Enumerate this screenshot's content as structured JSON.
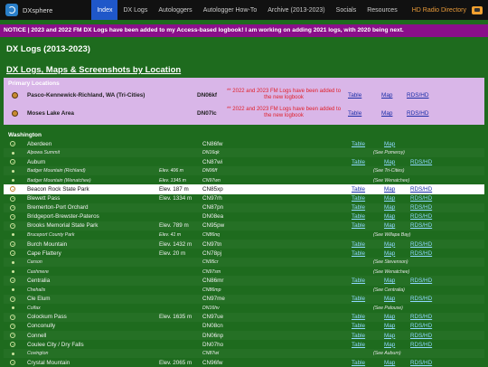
{
  "nav": {
    "brand": "DXsphere",
    "items": [
      {
        "label": "Index",
        "active": true
      },
      {
        "label": "DX Logs",
        "active": false
      },
      {
        "label": "Autologgers",
        "active": false
      },
      {
        "label": "Autologger How-To",
        "active": false
      },
      {
        "label": "Archive (2013-2023)",
        "active": false
      },
      {
        "label": "Socials",
        "active": false
      },
      {
        "label": "Resources",
        "active": false
      }
    ],
    "hd_label": "HD Radio Directory"
  },
  "notice": "NOTICE | 2023 and 2022 FM DX Logs have been added to my Access-based logbook! I am working on adding 2021 logs, with 2020 being next.",
  "page_title": "DX Logs (2013-2023)",
  "section_title": "DX Logs, Maps & Screenshots by Location",
  "primary": {
    "heading": "Primary Locations",
    "rows": [
      {
        "name": "Pasco-Kennewick-Richland, WA (Tri-Cities)",
        "grid": "DN06kf",
        "note": "** 2022 and 2023 FM Logs have been added to the new logbook",
        "table": "Table",
        "map": "Map",
        "rds": "RDS/HD"
      },
      {
        "name": "Moses Lake Area",
        "grid": "DN07lc",
        "note": "** 2022 and 2023 FM Logs have been added to the new logbook",
        "table": "Table",
        "map": "Map",
        "rds": "RDS/HD"
      }
    ]
  },
  "washington": {
    "heading": "Washington",
    "rows": [
      {
        "name": "Aberdeen",
        "elev": "",
        "grid": "CN86fw",
        "table": "Table",
        "map": "Map",
        "rds": "",
        "see": "",
        "small": false,
        "sel": false
      },
      {
        "name": "Alpowa Summit",
        "elev": "",
        "grid": "DN16qk",
        "table": "",
        "map": "",
        "rds": "",
        "see": "(See Pomeroy)",
        "small": true,
        "sel": false
      },
      {
        "name": "Auburn",
        "elev": "",
        "grid": "CN87wi",
        "table": "Table",
        "map": "Map",
        "rds": "RDS/HD",
        "see": "",
        "small": false,
        "sel": false
      },
      {
        "name": "Badger Mountain (Richland)",
        "elev": "Elev. 406 m",
        "grid": "DN06ff",
        "table": "",
        "map": "",
        "rds": "",
        "see": "(See Tri-Cities)",
        "small": true,
        "sel": false
      },
      {
        "name": "Badger Mountain (Wenatchee)",
        "elev": "Elev. 1345 m",
        "grid": "CN97wn",
        "table": "",
        "map": "",
        "rds": "",
        "see": "(See Wenatchee)",
        "small": true,
        "sel": false
      },
      {
        "name": "Beacon Rock State Park",
        "elev": "Elev. 187 m",
        "grid": "CN85xp",
        "table": "Table",
        "map": "Map",
        "rds": "RDS/HD",
        "see": "",
        "small": false,
        "sel": true
      },
      {
        "name": "Blewett Pass",
        "elev": "Elev. 1334 m",
        "grid": "CN97rh",
        "table": "Table",
        "map": "Map",
        "rds": "RDS/HD",
        "see": "",
        "small": false,
        "sel": false
      },
      {
        "name": "Bremerton-Port Orchard",
        "elev": "",
        "grid": "CN87pn",
        "table": "Table",
        "map": "Map",
        "rds": "RDS/HD",
        "see": "",
        "small": false,
        "sel": false
      },
      {
        "name": "Bridgeport-Brewster-Pateros",
        "elev": "",
        "grid": "DN08ea",
        "table": "Table",
        "map": "Map",
        "rds": "RDS/HD",
        "see": "",
        "small": false,
        "sel": false
      },
      {
        "name": "Brooks Memorial State Park",
        "elev": "Elev. 789 m",
        "grid": "CN95pw",
        "table": "Table",
        "map": "Map",
        "rds": "RDS/HD",
        "see": "",
        "small": false,
        "sel": false
      },
      {
        "name": "Bruceport County Park",
        "elev": "Elev. 41 m",
        "grid": "CN86nq",
        "table": "",
        "map": "",
        "rds": "",
        "see": "(See Willapa Bay)",
        "small": true,
        "sel": false
      },
      {
        "name": "Burch Mountain",
        "elev": "Elev. 1432 m",
        "grid": "CN97tn",
        "table": "Table",
        "map": "Map",
        "rds": "RDS/HD",
        "see": "",
        "small": false,
        "sel": false
      },
      {
        "name": "Cape Flattery",
        "elev": "Elev. 20 m",
        "grid": "CN78pj",
        "table": "Table",
        "map": "Map",
        "rds": "RDS/HD",
        "see": "",
        "small": false,
        "sel": false
      },
      {
        "name": "Carson",
        "elev": "",
        "grid": "CN95cr",
        "table": "",
        "map": "",
        "rds": "",
        "see": "(See Stevenson)",
        "small": true,
        "sel": false
      },
      {
        "name": "Cashmere",
        "elev": "",
        "grid": "CN97sm",
        "table": "",
        "map": "",
        "rds": "",
        "see": "(See Wenatchee)",
        "small": true,
        "sel": false
      },
      {
        "name": "Centralia",
        "elev": "",
        "grid": "CN86mr",
        "table": "Table",
        "map": "Map",
        "rds": "RDS/HD",
        "see": "",
        "small": false,
        "sel": false
      },
      {
        "name": "Chehalis",
        "elev": "",
        "grid": "CN86mp",
        "table": "",
        "map": "",
        "rds": "",
        "see": "(See Centralia)",
        "small": true,
        "sel": false
      },
      {
        "name": "Cle Elum",
        "elev": "",
        "grid": "CN97me",
        "table": "Table",
        "map": "Map",
        "rds": "RDS/HD",
        "see": "",
        "small": false,
        "sel": false
      },
      {
        "name": "Colfax",
        "elev": "",
        "grid": "DN16hv",
        "table": "",
        "map": "",
        "rds": "",
        "see": "(See Palouse)",
        "small": true,
        "sel": false
      },
      {
        "name": "Colockum Pass",
        "elev": "Elev. 1635 m",
        "grid": "CN97ue",
        "table": "Table",
        "map": "Map",
        "rds": "RDS/HD",
        "see": "",
        "small": false,
        "sel": false
      },
      {
        "name": "Conconully",
        "elev": "",
        "grid": "DN08cn",
        "table": "Table",
        "map": "Map",
        "rds": "RDS/HD",
        "see": "",
        "small": false,
        "sel": false
      },
      {
        "name": "Connell",
        "elev": "",
        "grid": "DN06np",
        "table": "Table",
        "map": "Map",
        "rds": "RDS/HD",
        "see": "",
        "small": false,
        "sel": false
      },
      {
        "name": "Coulee City / Dry Falls",
        "elev": "",
        "grid": "DN07ho",
        "table": "Table",
        "map": "Map",
        "rds": "RDS/HD",
        "see": "",
        "small": false,
        "sel": false
      },
      {
        "name": "Covington",
        "elev": "",
        "grid": "CN87wi",
        "table": "",
        "map": "",
        "rds": "",
        "see": "(See Auburn)",
        "small": true,
        "sel": false
      },
      {
        "name": "Crystal Mountain",
        "elev": "Elev. 2065 m",
        "grid": "CN96fw",
        "table": "Table",
        "map": "Map",
        "rds": "RDS/HD",
        "see": "",
        "small": false,
        "sel": false
      }
    ]
  }
}
